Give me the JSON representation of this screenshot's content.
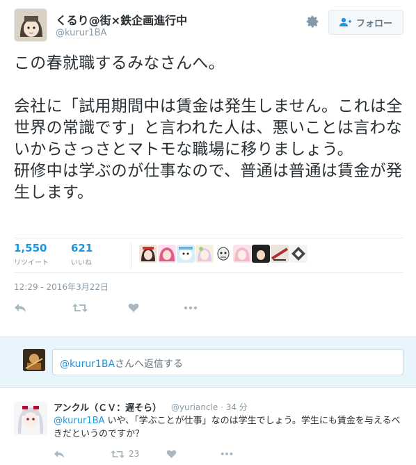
{
  "colors": {
    "accent": "#1b95e0",
    "text": "#292f33",
    "muted": "#8899a6",
    "reply_bg": "#e8f5fd",
    "border": "#e1e8ed"
  },
  "tweet": {
    "name": "くるり@街×鉄企画進行中",
    "handle": "@kurur1BA",
    "follow_label": "フォロー",
    "text": "この春就職するみなさんへ。\n\n会社に「試用期間中は賃金は発生しません。これは全世界の常識です」と言われた人は、悪いことは言わないからさっさとマトモな職場に移りましょう。\n研修中は学ぶのが仕事なので、普通は普通は賃金が発生します。",
    "retweets": {
      "count": "1,550",
      "label": "リツイート"
    },
    "likes": {
      "count": "621",
      "label": "いいね"
    },
    "timestamp": "12:29 - 2016年3月22日",
    "icons": [
      "reply-icon",
      "retweet-icon",
      "like-icon",
      "more-icon"
    ]
  },
  "reply_box": {
    "mention": "@kurur1BA",
    "text": "さんへ返信する"
  },
  "reply": {
    "name": "アンクル（ＣＶ：遅そら）",
    "handle": "@yuriancle",
    "time": "· 34 分",
    "mention": "@kurur1BA",
    "text": " いや、「学ぶことが仕事」なのは学生でしょう。学生にも賃金を与えるべきだというのですか？",
    "retweet_count": "23"
  }
}
